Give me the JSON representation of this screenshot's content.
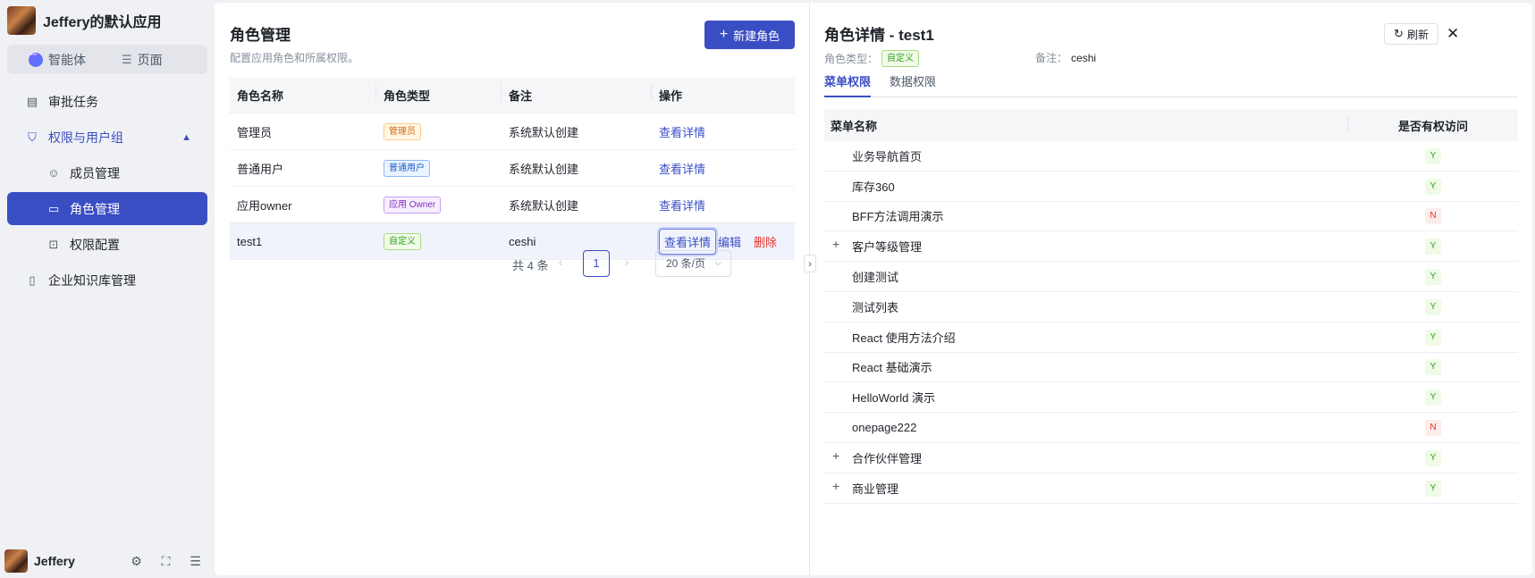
{
  "app": {
    "title": "Jeffery的默认应用"
  },
  "mode_switch": {
    "agent_label": "智能体",
    "page_label": "页面"
  },
  "nav": {
    "items": [
      {
        "label": "审批任务"
      },
      {
        "label": "权限与用户组"
      },
      {
        "label": "成员管理"
      },
      {
        "label": "角色管理"
      },
      {
        "label": "权限配置"
      },
      {
        "label": "企业知识库管理"
      }
    ]
  },
  "user": {
    "name": "Jeffery"
  },
  "roles": {
    "title": "角色管理",
    "description": "配置应用角色和所属权限。",
    "new_button": "新建角色",
    "columns": [
      "角色名称",
      "角色类型",
      "备注",
      "操作"
    ],
    "rows": [
      {
        "name": "管理员",
        "type": "管理员",
        "note": "系统默认创建",
        "view": "查看详情"
      },
      {
        "name": "普通用户",
        "type": "普通用户",
        "note": "系统默认创建",
        "view": "查看详情"
      },
      {
        "name": "应用owner",
        "type": "应用 Owner",
        "note": "系统默认创建",
        "view": "查看详情"
      },
      {
        "name": "test1",
        "type": "自定义",
        "note": "ceshi",
        "view": "查看详情",
        "edit": "编辑",
        "delete": "删除"
      }
    ],
    "pagination": {
      "total": "共 4 条",
      "current": "1",
      "page_size": "20 条/页"
    }
  },
  "detail": {
    "title": "角色详情 - test1",
    "refresh_label": "刷新",
    "type_label": "角色类型：",
    "type_value": "自定义",
    "note_label": "备注：",
    "note_value": "ceshi",
    "tabs": [
      "菜单权限",
      "数据权限"
    ],
    "columns": [
      "菜单名称",
      "是否有权访问"
    ],
    "rows": [
      {
        "name": "业务导航首页",
        "access": "Y"
      },
      {
        "name": "库存360",
        "access": "Y"
      },
      {
        "name": "BFF方法调用演示",
        "access": "N"
      },
      {
        "name": "客户等级管理",
        "access": "Y"
      },
      {
        "name": "创建测试",
        "access": "Y"
      },
      {
        "name": "测试列表",
        "access": "Y"
      },
      {
        "name": "React 使用方法介绍",
        "access": "Y"
      },
      {
        "name": "React 基础演示",
        "access": "Y"
      },
      {
        "name": "HelloWorld 演示",
        "access": "Y"
      },
      {
        "name": "onepage222",
        "access": "N"
      },
      {
        "name": "合作伙伴管理",
        "access": "Y"
      },
      {
        "name": "商业管理",
        "access": "Y"
      }
    ]
  },
  "colors": {
    "accent": "#3a4ec4",
    "danger": "#e5342b",
    "success": "#2f9e1a"
  }
}
